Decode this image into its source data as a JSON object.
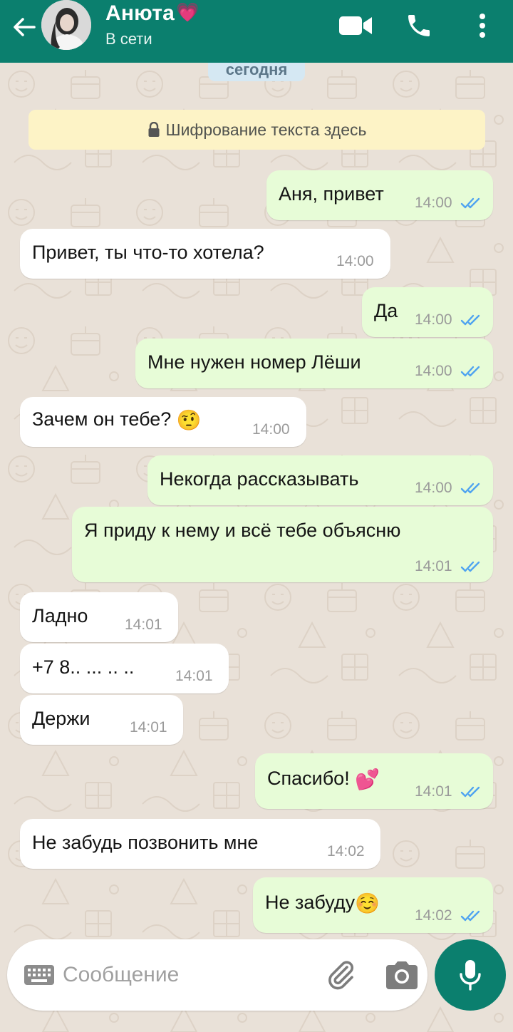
{
  "header": {
    "contact_name": "Анюта",
    "name_emoji": "💗",
    "status": "В сети",
    "icons": [
      "back-arrow-icon",
      "video-call-icon",
      "phone-icon",
      "more-vert-icon"
    ],
    "color": "#0b7f6e"
  },
  "chat": {
    "date_chip": "сегодня",
    "encryption_notice": "Шифрование текста здесь",
    "messages": [
      {
        "dir": "out",
        "text": "Аня, привет",
        "time": "14:00",
        "read": true
      },
      {
        "dir": "in",
        "text": "Привет, ты что-то хотела?",
        "time": "14:00"
      },
      {
        "dir": "out",
        "text": "Да",
        "time": "14:00",
        "read": true
      },
      {
        "dir": "out",
        "text": "Мне нужен номер Лёши",
        "time": "14:00",
        "read": true
      },
      {
        "dir": "in",
        "text": "Зачем он тебе?",
        "emoji": "🤨",
        "time": "14:00"
      },
      {
        "dir": "out",
        "text": "Некогда рассказывать",
        "time": "14:00",
        "read": true
      },
      {
        "dir": "out",
        "text": "Я приду к нему и всё тебе объясню",
        "time": "14:01",
        "read": true
      },
      {
        "dir": "in",
        "text": "Ладно",
        "time": "14:01"
      },
      {
        "dir": "in",
        "text": "+7 8.. ... .. ..",
        "time": "14:01"
      },
      {
        "dir": "in",
        "text": "Держи",
        "time": "14:01"
      },
      {
        "dir": "out",
        "text": "Спасибо!",
        "emoji": "💕",
        "time": "14:01",
        "read": true
      },
      {
        "dir": "in",
        "text": "Не забудь позвонить мне",
        "time": "14:02"
      },
      {
        "dir": "out",
        "text": "Не забуду",
        "emoji": "☺️",
        "time": "14:02",
        "read": true
      }
    ]
  },
  "composer": {
    "placeholder": "Сообщение",
    "icons": [
      "keyboard-icon",
      "attach-icon",
      "camera-icon",
      "mic-icon"
    ]
  },
  "colors": {
    "outgoing_bubble": "#e7fcd7",
    "incoming_bubble": "#ffffff",
    "read_ticks": "#4fa3f0",
    "background": "#e9e1d8"
  }
}
